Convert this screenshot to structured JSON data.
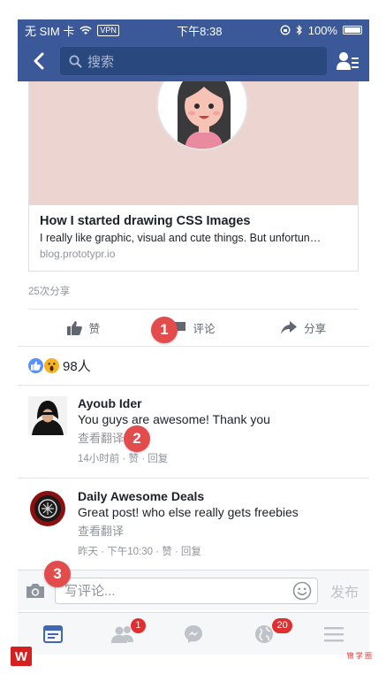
{
  "status_bar": {
    "carrier": "无 SIM 卡",
    "vpn": "VPN",
    "time": "下午8:38",
    "battery": "100%"
  },
  "nav": {
    "search_placeholder": "搜索"
  },
  "link_preview": {
    "title": "How I started drawing CSS Images",
    "description": "I really like graphic, visual and cute things. But unfortun…",
    "domain": "blog.prototypr.io"
  },
  "share_count": "25次分享",
  "actions": {
    "like": "赞",
    "comment": "评论",
    "share": "分享"
  },
  "reactions": {
    "count": "98人"
  },
  "comments": [
    {
      "author": "Ayoub Ider",
      "text": "You guys are awesome! Thank you",
      "translate": "查看翻译",
      "meta": "14小时前 · 赞 · 回复"
    },
    {
      "author": "Daily Awesome Deals",
      "text": "Great post! who else really gets freebies",
      "translate": "查看翻译",
      "meta": "昨天 · 下午10:30 · 赞 · 回复"
    }
  ],
  "composer": {
    "placeholder": "写评论...",
    "post_label": "发布"
  },
  "tabs": {
    "friend_requests_badge": "1",
    "notifications_badge": "20"
  },
  "markers": [
    "1",
    "2",
    "3"
  ],
  "watermark": {
    "logo": "W",
    "right": "锦 学 圈"
  },
  "colors": {
    "brand": "#3b5998",
    "badge": "#e02f2f",
    "marker": "#e34c4c"
  }
}
